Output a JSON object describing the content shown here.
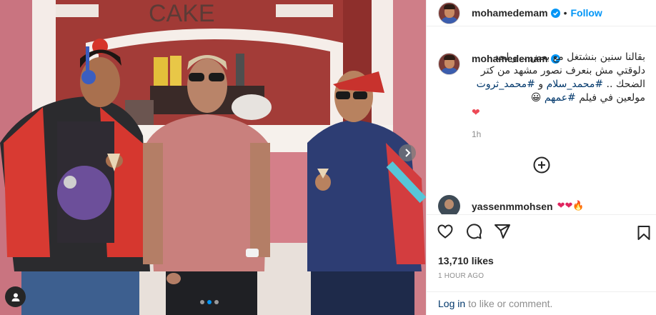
{
  "header": {
    "username": "mohamedemam",
    "separator": "•",
    "follow_label": "Follow"
  },
  "caption": {
    "username": "mohamedemam",
    "text_part1": "بقالنا سنين بنشتغل مع بعض .. و لحد دلوقتي مش بنعرف نصور مشهد من كتر الضحك .. ",
    "hashtag1": "#محمد_سلام",
    "text_part2": " و ",
    "hashtag2": "#محمد_ثروت",
    "text_part3": " مولعين في فيلم ",
    "hashtag3": "#عمهم",
    "text_emoji": " 😀",
    "heart": "❤",
    "time": "1h"
  },
  "comment": {
    "username": "yassenmmohsen",
    "text": "❤❤🔥"
  },
  "stats": {
    "likes": "13,710 likes",
    "posted": "1 HOUR AGO"
  },
  "footer": {
    "login_link": "Log in",
    "login_text": "to like or comment."
  },
  "photo": {
    "sign_text": "CAKE"
  },
  "icons": {
    "verified": "verified-badge-icon",
    "like": "heart-icon",
    "comment": "comment-icon",
    "share": "paper-plane-icon",
    "save": "bookmark-icon",
    "load_more": "plus-circle-icon",
    "next": "chevron-right-icon",
    "tag": "user-tag-icon"
  },
  "colors": {
    "accent": "#0095f6",
    "hashtag": "#00376b",
    "muted": "#8e8e8e"
  },
  "carousel": {
    "slides": 3,
    "active": 2
  }
}
